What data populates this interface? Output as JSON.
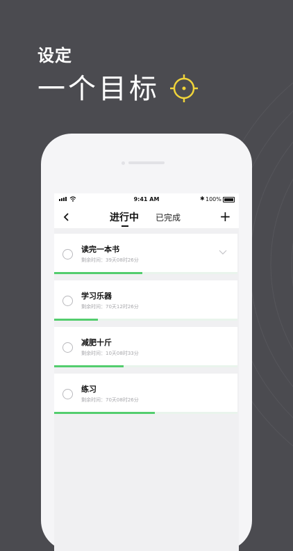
{
  "promo": {
    "line1": "设定",
    "line2": "一个目标",
    "accent_color": "#f0d43a"
  },
  "status_bar": {
    "time": "9:41 AM",
    "battery": "100%"
  },
  "nav": {
    "back_icon": "chevron-left-icon",
    "tab_active": "进行中",
    "tab_done": "已完成",
    "add_label": "+"
  },
  "goals": [
    {
      "title": "读完一本书",
      "remaining": "剩余时间：39天08时26分",
      "progress": 0.48,
      "expanded_icon": "chevron-down-icon"
    },
    {
      "title": "学习乐器",
      "remaining": "剩余时间：70天12时26分",
      "progress": 0.24
    },
    {
      "title": "减肥十斤",
      "remaining": "剩余时间：10天08时33分",
      "progress": 0.38
    },
    {
      "title": "练习",
      "remaining": "剩余时间：70天08时26分",
      "progress": 0.55
    }
  ],
  "colors": {
    "progress": "#53cd6e",
    "background": "#4b4b50"
  }
}
